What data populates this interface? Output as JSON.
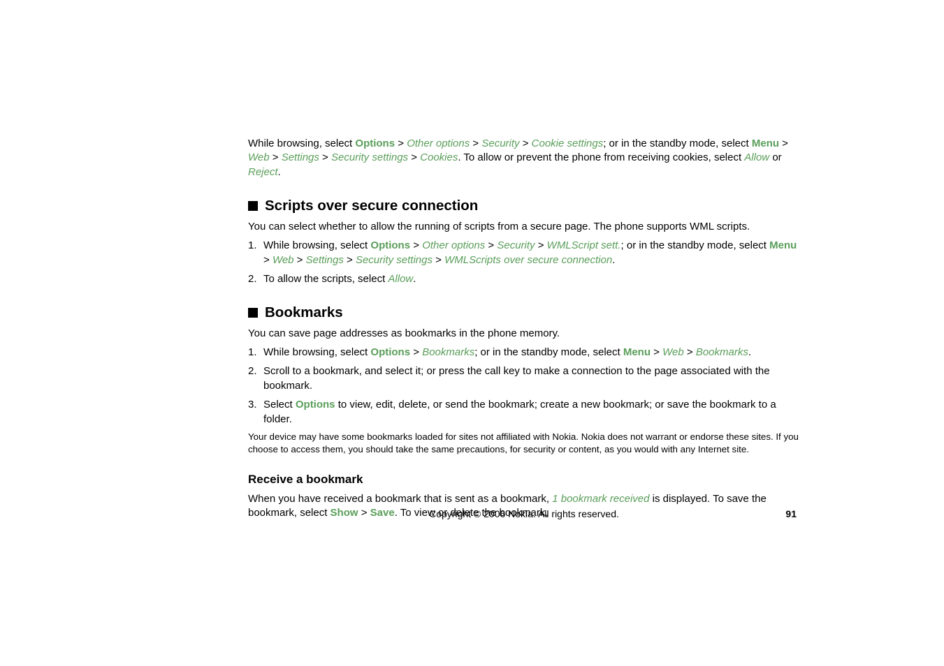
{
  "cookies_section": {
    "p1_t1": "While browsing, select ",
    "options": "Options",
    "sep": " > ",
    "other_options": "Other options",
    "security": "Security",
    "cookie_settings": "Cookie settings",
    "p1_t2": "; or in the standby mode, select ",
    "menu": "Menu",
    "web": "Web",
    "settings": "Settings",
    "security_settings": "Security settings",
    "cookies": "Cookies",
    "p1_t3": ". To allow or prevent the phone from receiving cookies, select ",
    "allow": "Allow",
    "or": " or ",
    "reject": "Reject",
    "period": "."
  },
  "scripts_section": {
    "title": "Scripts over secure connection",
    "intro": "You can select whether to allow the running of scripts from a secure page. The phone supports WML scripts.",
    "item1": {
      "num": "1.",
      "t1": "While browsing, select ",
      "options": "Options",
      "sep": " > ",
      "other_options": "Other options",
      "security": "Security",
      "wmlscript_sett": "WMLScript sett.",
      "t2": "; or in the standby mode, select ",
      "menu": "Menu",
      "web": "Web",
      "settings": "Settings",
      "security_settings": "Security settings",
      "wmlscripts_conn": "WMLScripts over secure connection",
      "period": "."
    },
    "item2": {
      "num": "2.",
      "t1": "To allow the scripts, select ",
      "allow": "Allow",
      "period": "."
    }
  },
  "bookmarks_section": {
    "title": "Bookmarks",
    "intro": "You can save page addresses as bookmarks in the phone memory.",
    "item1": {
      "num": "1.",
      "t1": "While browsing, select ",
      "options": "Options",
      "sep": " > ",
      "bookmarks": "Bookmarks",
      "t2": "; or in the standby mode, select ",
      "menu": "Menu",
      "web": "Web",
      "period": "."
    },
    "item2": {
      "num": "2.",
      "text": "Scroll to a bookmark, and select it; or press the call key to make a connection to the page associated with the bookmark."
    },
    "item3": {
      "num": "3.",
      "t1": "Select ",
      "options": "Options",
      "t2": " to view, edit, delete, or send the bookmark; create a new bookmark; or save the bookmark to a folder."
    },
    "disclaimer": "Your device may have some bookmarks loaded for sites not affiliated with Nokia. Nokia does not warrant or endorse these sites. If you choose to access them, you should take the same precautions, for security or content, as you would with any Internet site."
  },
  "receive_section": {
    "title": "Receive a bookmark",
    "t1": "When you have received a bookmark that is sent as a bookmark, ",
    "bookmark_received": "1 bookmark received",
    "t2": " is displayed. To save the bookmark, select ",
    "show": "Show",
    "sep": " > ",
    "save": "Save",
    "t3": ". To view or delete the bookmark,"
  },
  "footer": {
    "copyright": "Copyright © 2006 Nokia. All rights reserved.",
    "page": "91"
  }
}
